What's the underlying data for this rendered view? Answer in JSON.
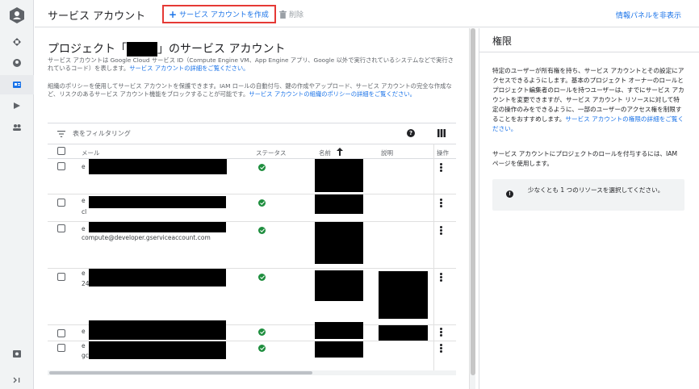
{
  "header": {
    "title": "サービス アカウント",
    "create_label": "サービス アカウントを作成",
    "delete_label": "削除",
    "hide_panel_label": "情報パネルを非表示"
  },
  "main": {
    "title_prefix": "プロジェクト「",
    "title_suffix": "」のサービス アカウント",
    "desc1_text": "サービス アカウントは Google Cloud サービス ID（Compute Engine VM、App Engine アプリ、Google 以外で実行されているシステムなどで実行されているコード）を表します。",
    "desc1_link": "サービス アカウントの詳細をご覧ください。",
    "desc2_text": "組織のポリシーを使用してサービス アカウントを保護できます。IAM ロールの自動付与、鍵の作成やアップロード、サービス アカウントの完全な作成など、リスクのあるサービス アカウント機能をブロックすることが可能です。",
    "desc2_link": "サービス アカウントの組織のポリシーの詳細をご覧ください。"
  },
  "filter": {
    "placeholder": "表をフィルタリング"
  },
  "table": {
    "columns": {
      "email": "メール",
      "status": "ステータス",
      "name": "名前",
      "desc": "説明",
      "ops": "操作"
    },
    "rows": [
      {
        "email_prefix": "e",
        "email_visible": ""
      },
      {
        "email_prefix": "e",
        "email_visible": "cl"
      },
      {
        "email_prefix": "e",
        "email_visible": "compute@developer.gserviceaccount.com"
      },
      {
        "email_prefix": "e",
        "email_visible": "24"
      },
      {
        "email_prefix": "e",
        "email_visible": ""
      },
      {
        "email_prefix": "e",
        "email_visible": "gcr"
      }
    ]
  },
  "panel": {
    "title": "権限",
    "body_text": "特定のユーザーが所有権を持ち、サービス アカウントとその設定にアクセスできるようにします。基本のプロジェクト オーナーのロールとプロジェクト編集者のロールを持つユーザーは、すでにサービス アカウントを変更できますが、サービス アカウント リソースに対して特定の操作のみをできるように、一部のユーザーのアクセス権を制限することをおすすめします。",
    "body_link": "サービス アカウントの権限の詳細をご覧ください。",
    "body2_text": "サービス アカウントにプロジェクトのロールを付与するには、IAM ページを使用します。",
    "notice_text": "少なくとも 1 つのリソースを選択してください。"
  },
  "colors": {
    "accent": "#1a73e8",
    "highlight_border": "#e53935",
    "status_ok": "#1e8e3e"
  }
}
